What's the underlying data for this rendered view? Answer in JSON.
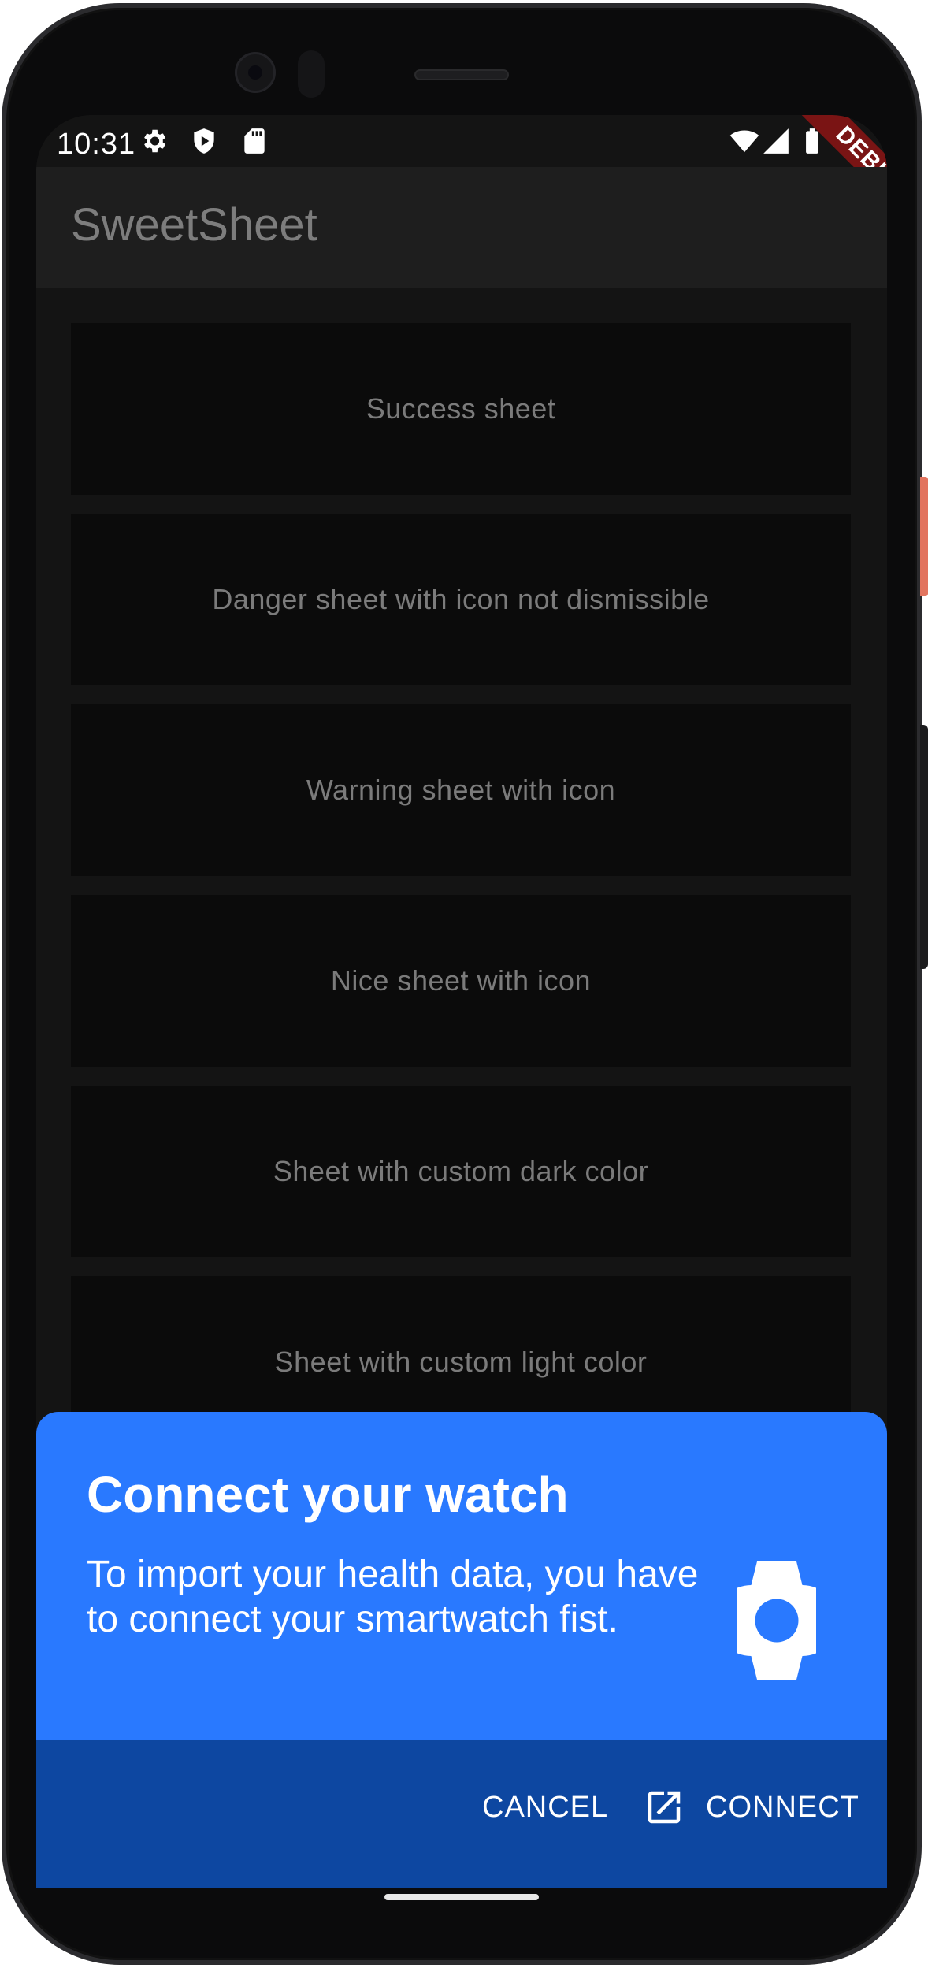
{
  "status_bar": {
    "time": "10:31",
    "left_icons": [
      "settings-icon",
      "shield-play-icon",
      "sd-card-icon"
    ],
    "right_icons": [
      "wifi-icon",
      "signal-icon",
      "battery-icon"
    ]
  },
  "debug_banner": "DEBUG",
  "app_bar": {
    "title": "SweetSheet"
  },
  "sheet_buttons": [
    {
      "label": "Success sheet"
    },
    {
      "label": "Danger sheet with icon not dismissible"
    },
    {
      "label": "Warning sheet with icon"
    },
    {
      "label": "Nice sheet with icon"
    },
    {
      "label": "Sheet with custom dark color"
    },
    {
      "label": "Sheet with custom light color"
    }
  ],
  "bottom_sheet": {
    "title": "Connect your watch",
    "description": "To import your health data, you have to connect your smartwatch fist.",
    "icon": "watch-icon",
    "cancel_label": "CANCEL",
    "connect_label": "CONNECT",
    "connect_icon": "open-in-new-icon",
    "colors": {
      "main": "#2979ff",
      "accent": "#0d47a1"
    }
  }
}
